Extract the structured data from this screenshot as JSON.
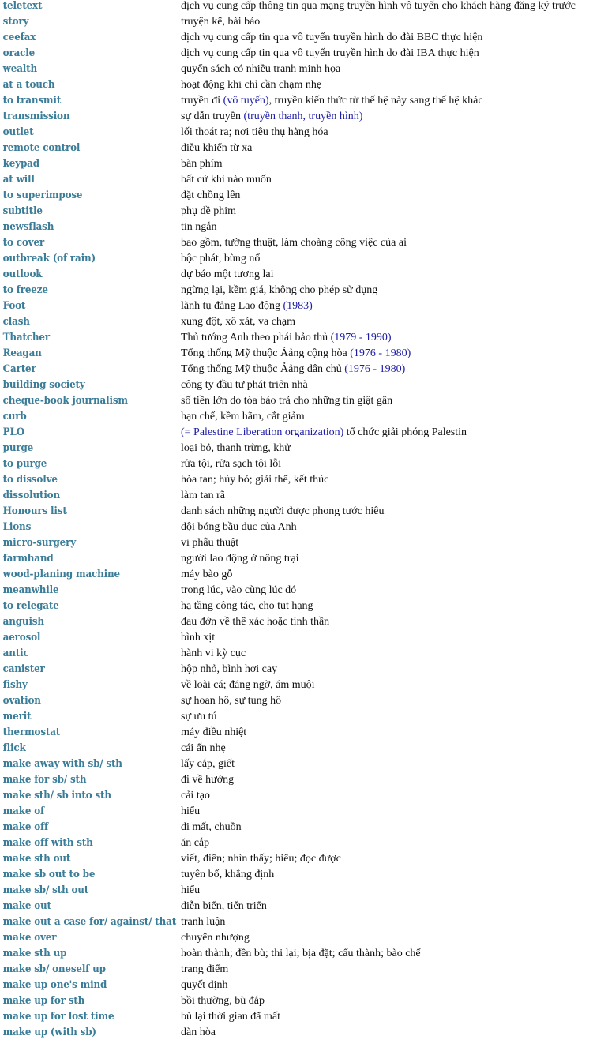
{
  "colors": {
    "term": "#3b7d98",
    "definition": "#111111",
    "note": "#1c1ca8",
    "background": "#ffffff"
  },
  "entries": [
    {
      "term": "teletext",
      "def": [
        {
          "t": "dịch vụ cung cấp thông tin qua mạng truyền hình vô tuyến cho khách hàng đăng ký trước"
        }
      ]
    },
    {
      "term": "story",
      "def": [
        {
          "t": "truyện kể, bài báo"
        }
      ]
    },
    {
      "term": "ceefax",
      "def": [
        {
          "t": "dịch vụ cung cấp tin qua vô tuyến truyền hình do đài BBC thực hiện"
        }
      ]
    },
    {
      "term": "oracle",
      "def": [
        {
          "t": "dịch vụ cung cấp tin qua vô tuyến truyền hình do đài IBA thực hiện"
        }
      ]
    },
    {
      "term": "wealth",
      "def": [
        {
          "t": "quyển sách có nhiều tranh minh họa"
        }
      ]
    },
    {
      "term": "at a touch",
      "def": [
        {
          "t": "hoạt động khi chỉ cần chạm nhẹ"
        }
      ]
    },
    {
      "term": "to transmit",
      "def": [
        {
          "t": "truyền đi "
        },
        {
          "t": "(vô tuyến)",
          "note": true
        },
        {
          "t": ", truyền kiến thức từ thế hệ này sang thế hệ khác"
        }
      ]
    },
    {
      "term": "transmission",
      "def": [
        {
          "t": "sự dẫn truyền "
        },
        {
          "t": "(truyền thanh, truyền hình)",
          "note": true
        }
      ]
    },
    {
      "term": "outlet",
      "def": [
        {
          "t": "lối thoát ra; nơi tiêu thụ hàng hóa"
        }
      ]
    },
    {
      "term": "remote control",
      "def": [
        {
          "t": "điều khiển từ xa"
        }
      ]
    },
    {
      "term": "keypad",
      "def": [
        {
          "t": "bàn phím"
        }
      ]
    },
    {
      "term": "at will",
      "def": [
        {
          "t": "bất cứ khi nào muốn"
        }
      ]
    },
    {
      "term": "to superimpose",
      "def": [
        {
          "t": "đặt chồng lên"
        }
      ]
    },
    {
      "term": "subtitle",
      "def": [
        {
          "t": "phụ đề phim"
        }
      ]
    },
    {
      "term": "newsflash",
      "def": [
        {
          "t": "tin ngắn"
        }
      ]
    },
    {
      "term": "to cover",
      "def": [
        {
          "t": "bao gồm, tường thuật, làm choàng công việc của ai"
        }
      ]
    },
    {
      "term": "outbreak (of rain)",
      "def": [
        {
          "t": "bộc phát, bùng nổ"
        }
      ]
    },
    {
      "term": "outlook",
      "def": [
        {
          "t": "dự báo một tương lai"
        }
      ]
    },
    {
      "term": "to freeze",
      "def": [
        {
          "t": "ngừng lại, kềm giá, không cho phép sử dụng"
        }
      ]
    },
    {
      "term": "Foot",
      "def": [
        {
          "t": "lãnh tụ đảng Lao động "
        },
        {
          "t": "(1983)",
          "note": true
        }
      ]
    },
    {
      "term": "clash",
      "def": [
        {
          "t": "xung đột, xô xát, va chạm"
        }
      ]
    },
    {
      "term": "Thatcher",
      "def": [
        {
          "t": "Thủ tướng Anh theo phái bảo thủ "
        },
        {
          "t": "(1979 - 1990)",
          "note": true
        }
      ]
    },
    {
      "term": "Reagan",
      "def": [
        {
          "t": "Tổng thống Mỹ thuộc Ảảng cộng hòa "
        },
        {
          "t": "(1976 - 1980)",
          "note": true
        }
      ]
    },
    {
      "term": "Carter",
      "def": [
        {
          "t": "Tổng thống Mỹ thuộc Ảảng dân chủ "
        },
        {
          "t": "(1976 - 1980)",
          "note": true
        }
      ]
    },
    {
      "term": "building society",
      "def": [
        {
          "t": "công ty đầu tư phát triển nhà"
        }
      ]
    },
    {
      "term": "cheque-book journalism",
      "def": [
        {
          "t": "số tiền lớn do tòa báo trả cho những tin giật gân"
        }
      ]
    },
    {
      "term": "curb",
      "def": [
        {
          "t": "hạn chế, kềm hãm, cắt giảm"
        }
      ]
    },
    {
      "term": "PLO",
      "def": [
        {
          "t": "(= Palestine Liberation organization)",
          "note": true
        },
        {
          "t": " tổ chức giải phóng Palestin"
        }
      ]
    },
    {
      "term": "purge",
      "def": [
        {
          "t": "loại bỏ, thanh trừng, khử"
        }
      ]
    },
    {
      "term": "to purge",
      "def": [
        {
          "t": "rửa tội, rửa sạch tội lỗi"
        }
      ]
    },
    {
      "term": "to dissolve",
      "def": [
        {
          "t": "hòa tan; hủy bỏ; giải thể, kết thúc"
        }
      ]
    },
    {
      "term": "dissolution",
      "def": [
        {
          "t": "làm tan rã"
        }
      ]
    },
    {
      "term": "Honours list",
      "def": [
        {
          "t": "danh sách những người được phong tước hiêu"
        }
      ]
    },
    {
      "term": "Lions",
      "def": [
        {
          "t": "đội bóng bầu dục của Anh"
        }
      ]
    },
    {
      "term": "micro-surgery",
      "def": [
        {
          "t": "vi phẫu thuật"
        }
      ]
    },
    {
      "term": "farmhand",
      "def": [
        {
          "t": "người lao động ở nông trại"
        }
      ]
    },
    {
      "term": "wood-planing machine",
      "def": [
        {
          "t": "máy bào gỗ"
        }
      ]
    },
    {
      "term": "meanwhile",
      "def": [
        {
          "t": "trong lúc, vào cùng lúc đó"
        }
      ]
    },
    {
      "term": "to relegate",
      "def": [
        {
          "t": "hạ tầng công tác, cho tụt hạng"
        }
      ]
    },
    {
      "term": "anguish",
      "def": [
        {
          "t": "đau đớn về thể xác hoặc tinh thần"
        }
      ]
    },
    {
      "term": "aerosol",
      "def": [
        {
          "t": "bình xịt"
        }
      ]
    },
    {
      "term": "antic",
      "def": [
        {
          "t": "hành vi kỳ cục"
        }
      ]
    },
    {
      "term": "canister",
      "def": [
        {
          "t": "hộp nhỏ, bình hơi cay"
        }
      ]
    },
    {
      "term": "fishy",
      "def": [
        {
          "t": "về loài cá; đáng ngờ, ám muội"
        }
      ]
    },
    {
      "term": "ovation",
      "def": [
        {
          "t": "sự hoan hô, sự tung hô"
        }
      ]
    },
    {
      "term": "merit",
      "def": [
        {
          "t": "sự ưu tú"
        }
      ]
    },
    {
      "term": "thermostat",
      "def": [
        {
          "t": "máy điều nhiệt"
        }
      ]
    },
    {
      "term": "flick",
      "def": [
        {
          "t": "cái ấn nhẹ"
        }
      ]
    },
    {
      "term": "make away with sb/ sth",
      "def": [
        {
          "t": "lấy cắp, giết"
        }
      ]
    },
    {
      "term": "make for sb/ sth",
      "def": [
        {
          "t": "đi về hướng"
        }
      ]
    },
    {
      "term": "make sth/ sb into sth",
      "def": [
        {
          "t": "cải tạo"
        }
      ]
    },
    {
      "term": "make of",
      "def": [
        {
          "t": "hiểu"
        }
      ]
    },
    {
      "term": "make off",
      "def": [
        {
          "t": "đi mất, chuồn"
        }
      ]
    },
    {
      "term": "make off with sth",
      "def": [
        {
          "t": "ăn cắp"
        }
      ]
    },
    {
      "term": "make sth out",
      "def": [
        {
          "t": "viết, điền; nhìn thấy; hiểu; đọc được"
        }
      ]
    },
    {
      "term": "make sb out to be",
      "def": [
        {
          "t": "tuyên bố, khẳng định"
        }
      ]
    },
    {
      "term": "make sb/ sth out",
      "def": [
        {
          "t": "hiểu"
        }
      ]
    },
    {
      "term": "make out",
      "def": [
        {
          "t": "diễn biến, tiến triển"
        }
      ]
    },
    {
      "term": "make out a case for/ against/ that",
      "def": [
        {
          "t": "tranh luận"
        }
      ]
    },
    {
      "term": "make over",
      "def": [
        {
          "t": "chuyển nhượng"
        }
      ]
    },
    {
      "term": "make sth up",
      "def": [
        {
          "t": "hoàn thành; đền bù; thi lại; bịa đặt; cấu thành; bào chế"
        }
      ]
    },
    {
      "term": "make sb/ oneself up",
      "def": [
        {
          "t": "trang điểm"
        }
      ]
    },
    {
      "term": "make up one's mind",
      "def": [
        {
          "t": "quyết định"
        }
      ]
    },
    {
      "term": "make up for sth",
      "def": [
        {
          "t": "bồi thường, bù đắp"
        }
      ]
    },
    {
      "term": "make up for lost time",
      "def": [
        {
          "t": "bù lại thời gian đã mất"
        }
      ]
    },
    {
      "term": "make up (with sb)",
      "def": [
        {
          "t": "dàn hòa"
        }
      ]
    }
  ]
}
